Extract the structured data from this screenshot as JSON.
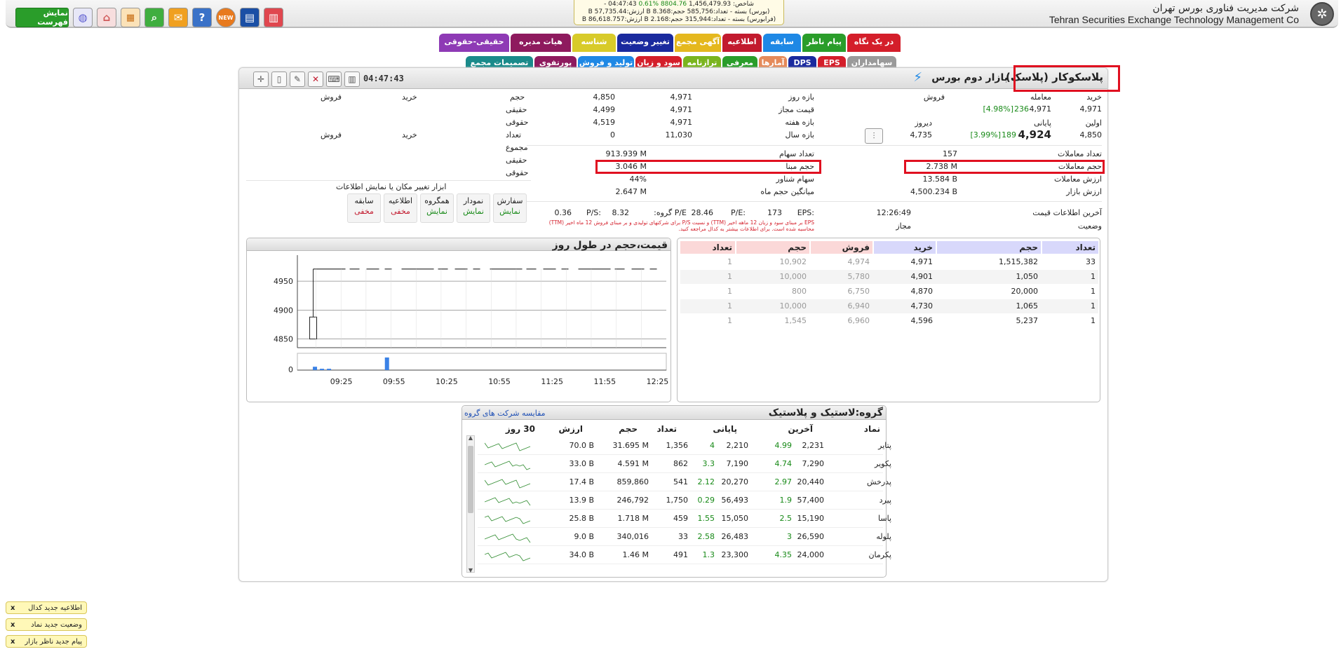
{
  "topbar": {
    "show_list_label": "نمایش فهرست",
    "company_fa": "شرکت مدیریت فناوری بورس تهران",
    "company_en": "Tehran Securities Exchange Technology Management Co",
    "ticker": {
      "line1_index": "شاخص: 1,456,479.93",
      "line1_change": "8804.76 %0.61",
      "line1_time": "04:47:43 -",
      "line2": "(بورس) بسته - تعداد:585,756 حجم:8.368 B ارزش:57,735.44 B",
      "line3": "(فرابورس) بسته - تعداد:315,944 حجم:2.168 B ارزش:86,618.757 B"
    },
    "icons": [
      "grid-icon",
      "chart-book-icon",
      "new-badge-icon",
      "help-icon",
      "message-icon",
      "search-icon",
      "table-icon",
      "home-icon",
      "globe-icon"
    ],
    "new_badge": "NEW"
  },
  "tabs_row1": [
    {
      "label": "در یک نگاه",
      "color": "#d41e2a"
    },
    {
      "label": "پیام ناظر",
      "color": "#2a9d2a"
    },
    {
      "label": "سابقه",
      "color": "#1e88e5"
    },
    {
      "label": "اطلاعیه",
      "color": "#c21a2e"
    },
    {
      "label": "آگهی مجمع",
      "color": "#e5b81e"
    },
    {
      "label": "تغییر وضعیت",
      "color": "#1a2a9e"
    },
    {
      "label": "شناسه",
      "color": "#d8cb2a"
    },
    {
      "label": "هیات مدیره",
      "color": "#8e1a5e"
    },
    {
      "label": "حقیقی-حقوقی",
      "color": "#8e3ab5"
    }
  ],
  "tabs_row2": [
    {
      "label": "سهامداران",
      "color": "#9a9a9a"
    },
    {
      "label": "EPS",
      "color": "#d41e2a"
    },
    {
      "label": "DPS",
      "color": "#1a2a9e"
    },
    {
      "label": "آمارها",
      "color": "#e58a5a"
    },
    {
      "label": "معرفی",
      "color": "#2a9d2a"
    },
    {
      "label": "ترازنامه",
      "color": "#7ab51e"
    },
    {
      "label": "سود و زیان",
      "color": "#d41e2a"
    },
    {
      "label": "تولید و فروش",
      "color": "#1e88e5"
    },
    {
      "label": "پورتفوی",
      "color": "#8e1a5e"
    },
    {
      "label": "تصمیمات مجمع",
      "color": "#1a8a8a"
    }
  ],
  "header": {
    "symbol": "پلاسکوکار (پلاسک)",
    "market": "بازار دوم بورس",
    "clock": "04:47:43"
  },
  "price_block": {
    "buy_label": "خرید",
    "trade_label": "معامله",
    "sell_label": "فروش",
    "buy_value": "4,971",
    "trade_value": "4,971",
    "trade_change": "236",
    "trade_pct": "[4.98%]",
    "first_label": "اولین",
    "first_value": "4,850",
    "final_label": "پایانی",
    "final_value": "4,924",
    "final_change": "189",
    "final_pct": "[3.99%]",
    "yesterday_label": "دیروز",
    "yesterday_value": "4,735"
  },
  "range_block": {
    "day_range_label": "بازه روز",
    "day_range": [
      "4,971",
      "4,850"
    ],
    "allowed_label": "قیمت مجاز",
    "allowed": [
      "4,971",
      "4,499"
    ],
    "week_label": "بازه هفته",
    "week": [
      "4,971",
      "4,519"
    ],
    "year_label": "بازه سال",
    "year": [
      "11,030",
      "0"
    ]
  },
  "stats_left": {
    "trades_count_label": "تعداد معاملات",
    "trades_count": "157",
    "trades_volume_label": "حجم معاملات",
    "trades_volume": "2.738 M",
    "trades_value_label": "ارزش معاملات",
    "trades_value": "13.584 B",
    "market_value_label": "ارزش بازار",
    "market_value": "4,500.234 B"
  },
  "stats_right": {
    "shares_label": "تعداد سهام",
    "shares": "913.939 M",
    "base_volume_label": "حجم مبنا",
    "base_volume": "3.046 M",
    "float_label": "سهام شناور",
    "float": "44%",
    "avg_month_label": "میانگین حجم ماه",
    "avg_month": "2.647 M"
  },
  "last_info": {
    "last_info_label": "آخرین اطلاعات قیمت",
    "last_info_time": "12:26:49",
    "status_label": "وضعیت",
    "status": "مجاز"
  },
  "ratios": {
    "eps_label": "EPS:",
    "eps": "173",
    "pe_label": "P/E:",
    "pe": "28.46",
    "group_pe_label": "P/E گروه:",
    "group_pe": "8.32",
    "ps_label": "P/S:",
    "ps": "0.36",
    "note": "EPS بر مبنای سود و زیان 12 ماهه اخیر (TTM) و نسبت P/S برای شرکتهای تولیدی و بر مبنای فروش 12 ماه اخیر (TTM) محاسبه شده است. برای اطلاعات بیشتر به کدال مراجعه کنید."
  },
  "person_table": {
    "hdr_volume": "حجم",
    "hdr_buy": "خرید",
    "hdr_sell": "فروش",
    "real": "حقیقی",
    "legal": "حقوقی",
    "hdr_count": "تعداد",
    "total": "مجموع"
  },
  "toolbox": {
    "title": "ابزار تغییر مکان یا نمایش اطلاعات",
    "buttons": [
      {
        "label": "سفارش",
        "state": "نمایش",
        "color": "#188a18"
      },
      {
        "label": "نمودار",
        "state": "نمایش",
        "color": "#188a18"
      },
      {
        "label": "همگروه",
        "state": "نمایش",
        "color": "#188a18"
      },
      {
        "label": "اطلاعیه",
        "state": "مخفی",
        "color": "#c21a2e"
      },
      {
        "label": "سابقه",
        "state": "مخفی",
        "color": "#c21a2e"
      }
    ]
  },
  "orderbook": {
    "headers": {
      "count": "تعداد",
      "volume": "حجم",
      "buy": "خرید",
      "sell": "فروش"
    },
    "rows": [
      {
        "buy_count": "33",
        "buy_volume": "1,515,382",
        "buy_price": "4,971",
        "sell_price": "4,974",
        "sell_volume": "10,902",
        "sell_count": "1"
      },
      {
        "buy_count": "1",
        "buy_volume": "1,050",
        "buy_price": "4,901",
        "sell_price": "5,780",
        "sell_volume": "10,000",
        "sell_count": "1"
      },
      {
        "buy_count": "1",
        "buy_volume": "20,000",
        "buy_price": "4,870",
        "sell_price": "6,750",
        "sell_volume": "800",
        "sell_count": "1"
      },
      {
        "buy_count": "1",
        "buy_volume": "1,065",
        "buy_price": "4,730",
        "sell_price": "6,940",
        "sell_volume": "10,000",
        "sell_count": "1"
      },
      {
        "buy_count": "1",
        "buy_volume": "5,237",
        "buy_price": "4,596",
        "sell_price": "6,960",
        "sell_volume": "1,545",
        "sell_count": "1"
      }
    ]
  },
  "chart_data": {
    "type": "line",
    "title": "قیمت،حجم در طول روز",
    "x_ticks": [
      "09:25",
      "09:55",
      "10:25",
      "10:55",
      "11:25",
      "11:55",
      "12:25"
    ],
    "y_ticks": [
      4850,
      4900,
      4950
    ],
    "ylim": [
      4835,
      4995
    ],
    "volume_tick": "0",
    "price_series": {
      "name": "",
      "start": "09:09",
      "open_low": 4850,
      "open_high": 4888,
      "price": 4971,
      "end": "12:30"
    },
    "volume_bars": [
      {
        "time": "09:10",
        "level": 0.2
      },
      {
        "time": "09:14",
        "level": 0.08
      },
      {
        "time": "09:18",
        "level": 0.08
      },
      {
        "time": "09:51",
        "level": 0.75
      }
    ]
  },
  "group": {
    "title": "گروه:لاستیک و پلاستیک",
    "compare_link": "مقایسه شرکت های گروه",
    "headers": {
      "symbol": "نماد",
      "last": "آخرین",
      "final": "پایانی",
      "count": "تعداد",
      "volume": "حجم",
      "value": "ارزش",
      "days30": "30 روز"
    },
    "rows": [
      {
        "symbol": "پتایر",
        "last": "2,231",
        "last_ch": "4.99",
        "final": "2,210",
        "final_ch": "4",
        "count": "1,356",
        "volume": "31.695 M",
        "value": "70.0 B"
      },
      {
        "symbol": "پکویر",
        "last": "7,290",
        "last_ch": "4.74",
        "final": "7,190",
        "final_ch": "3.3",
        "count": "862",
        "volume": "4.591 M",
        "value": "33.0 B"
      },
      {
        "symbol": "پدرخش",
        "last": "20,440",
        "last_ch": "2.97",
        "final": "20,270",
        "final_ch": "2.12",
        "count": "541",
        "volume": "859,860",
        "value": "17.4 B"
      },
      {
        "symbol": "پیرد",
        "last": "57,400",
        "last_ch": "1.9",
        "final": "56,493",
        "final_ch": "0.29",
        "count": "1,750",
        "volume": "246,792",
        "value": "13.9 B"
      },
      {
        "symbol": "پاسا",
        "last": "15,190",
        "last_ch": "2.5",
        "final": "15,050",
        "final_ch": "1.55",
        "count": "459",
        "volume": "1.718 M",
        "value": "25.8 B"
      },
      {
        "symbol": "پلوله",
        "last": "26,590",
        "last_ch": "3",
        "final": "26,483",
        "final_ch": "2.58",
        "count": "33",
        "volume": "340,016",
        "value": "9.0 B"
      },
      {
        "symbol": "پکرمان",
        "last": "24,000",
        "last_ch": "4.35",
        "final": "23,300",
        "final_ch": "1.3",
        "count": "491",
        "volume": "1.46 M",
        "value": "34.0 B"
      }
    ]
  },
  "notifications": [
    {
      "label": "اطلاعیه جدید کدال",
      "close": "x"
    },
    {
      "label": "وضعیت جدید نماد",
      "close": "x"
    },
    {
      "label": "پیام جدید ناظر بازار",
      "close": "x"
    }
  ]
}
